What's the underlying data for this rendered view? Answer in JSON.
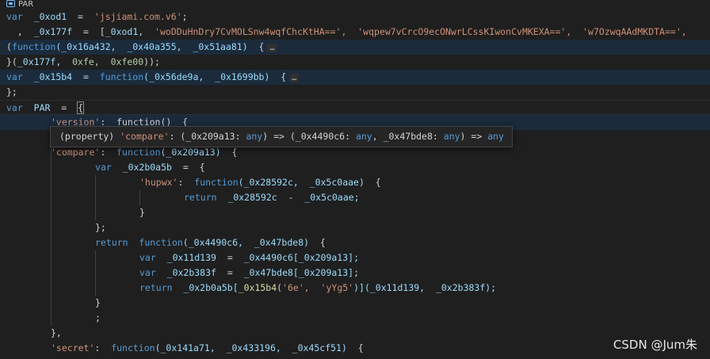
{
  "breadcrumb": {
    "icon": "symbol-variable-icon",
    "label": "PAR"
  },
  "lines": {
    "l1": {
      "kw": "var",
      "name": "_0xod1",
      "eq": "=",
      "str": "'jsjiami.com.v6'"
    },
    "l2": {
      "lead": ",",
      "name": "_0x177f",
      "eq": "=",
      "open": "[",
      "a0": "_0xod1,",
      "a1": "'woDDuHnDry7CvMOLSnw4wqfChcKtHA==',",
      "a2": "'wqpew7vCrcO9ecONwrLCssKIwonCvMKEXA==',",
      "a3": "'w7OzwqAAdMKDTA==',"
    },
    "l3": {
      "open": "(",
      "kw": "function",
      "args": "(_0x16a432,  _0x40a355,  _0x51aa81)",
      "brace": "{",
      "fold": "…"
    },
    "l4": {
      "close": "}(",
      "a0": "_0x177f,",
      "n1": "0xfe,",
      "n2": "0xfe00",
      "end": "));"
    },
    "l5": {
      "kw": "var",
      "name": "_0x15b4",
      "eq": "=",
      "fn": "function",
      "args": "(_0x56de9a,  _0x1699bb)",
      "brace": "{",
      "fold": "…"
    },
    "l6": {
      "text": "};"
    },
    "l7": {
      "kw": "var",
      "name": "PAR",
      "eq": "=",
      "brace": "{"
    },
    "l8": {
      "str": "'version'",
      "rest": ":  function()  {"
    },
    "l9": {
      "str": "'compare'",
      "colon": ":",
      "fn": "function",
      "args": "(_0x209a13)",
      "brace": "{"
    },
    "l10": {
      "kw": "var",
      "name": "_0x2b0a5b",
      "eq": "=",
      "brace": "{"
    },
    "l11": {
      "str": "'hupwx'",
      "colon": ":",
      "fn": "function",
      "args": "(_0x28592c,  _0x5c0aae)",
      "brace": "{"
    },
    "l12": {
      "kw": "return",
      "a": "_0x28592c",
      "op": "-",
      "b": "_0x5c0aae;"
    },
    "l13": {
      "text": "}"
    },
    "l14": {
      "text": "};"
    },
    "l15": {
      "kw": "return",
      "fn": "function",
      "args": "(_0x4490c6,  _0x47bde8)",
      "brace": "{"
    },
    "l16": {
      "kw": "var",
      "name": "_0x11d139",
      "eq": "=",
      "expr": "_0x4490c6[_0x209a13];"
    },
    "l17": {
      "kw": "var",
      "name": "_0x2b383f",
      "eq": "=",
      "expr": "_0x47bde8[_0x209a13];"
    },
    "l18": {
      "kw": "return",
      "obj": "_0x2b0a5b[",
      "call": "_0x15b4",
      "s1": "'6e',",
      "s2": "'yYg5'",
      "rest": ")](_0x11d139,  _0x2b383f);"
    },
    "l19": {
      "text": "}"
    },
    "l20": {
      "text": ";"
    },
    "l21": {
      "text": "},"
    },
    "l22": {
      "str": "'secret'",
      "colon": ":",
      "fn": "function",
      "args": "(_0x141a71,  _0x433196,  _0x45cf51)",
      "brace": "{"
    }
  },
  "hover": {
    "p1": "(property)",
    "name": "'compare'",
    "p2": ": (_0x209a13:",
    "t1": "any",
    "p3": ") => (_0x4490c6:",
    "t2": "any",
    "p4": ", _0x47bde8:",
    "t3": "any",
    "p5": ") =>",
    "t4": "any"
  },
  "watermark": "CSDN @Jum朱"
}
